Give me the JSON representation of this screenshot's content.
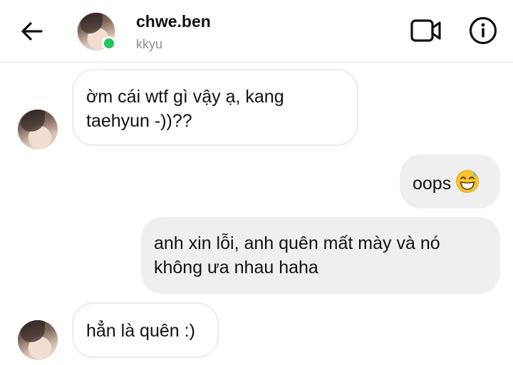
{
  "header": {
    "name": "chwe.ben",
    "username": "kkyu",
    "online_color": "#22c55e",
    "icons": {
      "back": "back-arrow-icon",
      "video": "video-call-icon",
      "info": "info-icon"
    }
  },
  "messages": [
    {
      "direction": "incoming",
      "text": "ờm cái wtf gì vậy ạ, kang taehyun -))??"
    },
    {
      "direction": "outgoing",
      "text": "oops",
      "emoji": "grinning-face-with-sweat-emoji"
    },
    {
      "direction": "outgoing",
      "text": "anh xin lỗi, anh quên mất mày và nó không ưa nhau haha"
    },
    {
      "direction": "incoming",
      "text": "hẳn là quên :)"
    }
  ]
}
